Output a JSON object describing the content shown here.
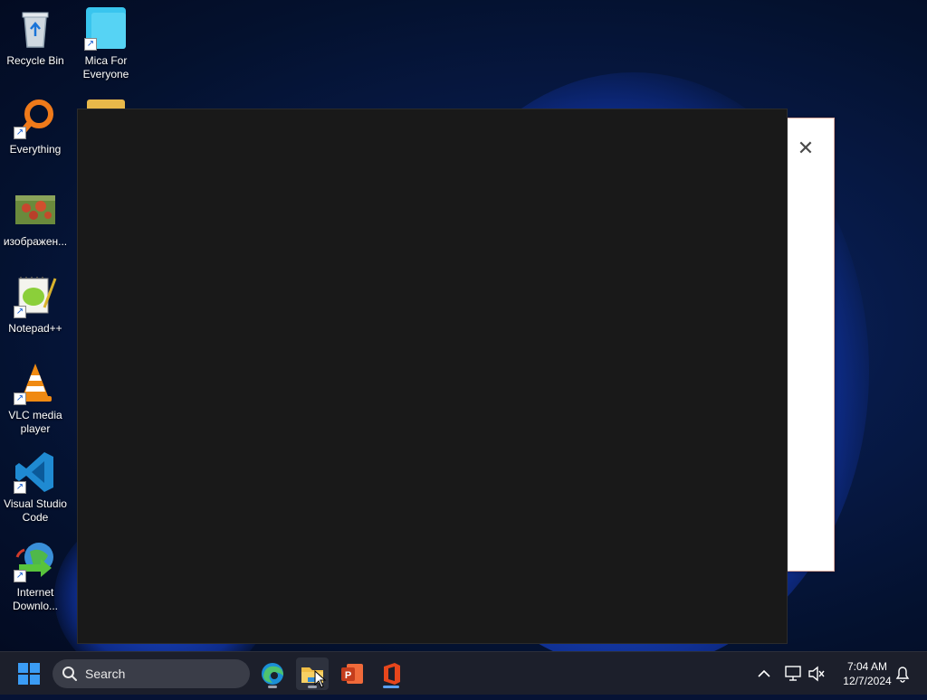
{
  "desktop": {
    "icons": [
      {
        "label": "Recycle Bin",
        "icon": "recycle-bin-icon"
      },
      {
        "label": "Mica For Everyone",
        "icon": "mica-app-icon"
      },
      {
        "label": "Everything",
        "icon": "everything-search-icon"
      },
      {
        "label": "изображен...",
        "icon": "image-file-icon"
      },
      {
        "label": "Notepad++",
        "icon": "notepadpp-icon"
      },
      {
        "label": "VLC media player",
        "icon": "vlc-icon"
      },
      {
        "label": "Visual Studio Code",
        "icon": "vscode-icon"
      },
      {
        "label": "Internet Downlo...",
        "icon": "idm-icon"
      }
    ]
  },
  "dialog": {
    "close_glyph": "✕"
  },
  "taskbar": {
    "search_placeholder": "Search",
    "apps": [
      {
        "name": "Microsoft Edge",
        "icon": "edge-icon"
      },
      {
        "name": "File Explorer",
        "icon": "folder-icon",
        "active": true
      },
      {
        "name": "PowerPoint",
        "icon": "powerpoint-icon"
      },
      {
        "name": "Office",
        "icon": "office-icon"
      }
    ],
    "tray": {
      "time": "7:04 AM",
      "date": "12/7/2024"
    }
  },
  "colors": {
    "accent": "#3b9cf5",
    "window_bg": "#191919",
    "taskbar_bg": "#1c1f2b"
  }
}
